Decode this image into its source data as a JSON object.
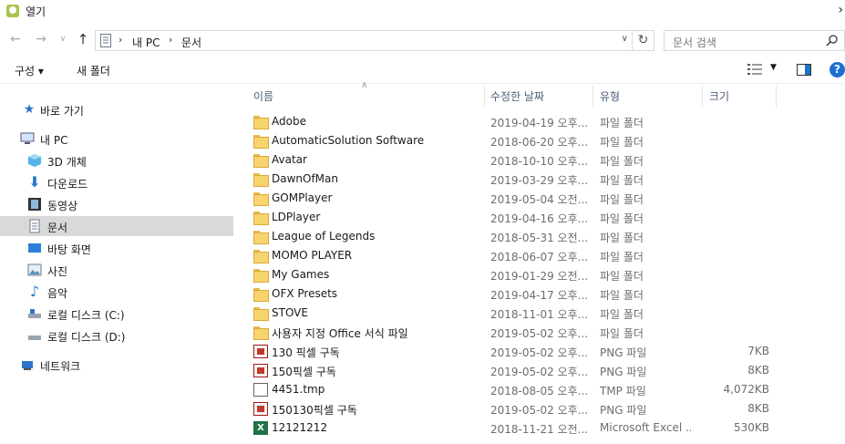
{
  "window": {
    "title": "열기"
  },
  "address": {
    "crumbs": [
      "내 PC",
      "문서"
    ],
    "search_placeholder": "문서 검색"
  },
  "toolbar": {
    "organize_label": "구성 ▾",
    "new_folder_label": "새 폴더"
  },
  "sidebar": {
    "items": [
      {
        "label": "바로 가기",
        "icon": "star-icon"
      },
      {
        "label": "내 PC",
        "icon": "pc-icon"
      },
      {
        "label": "3D 개체",
        "icon": "cube-3d-icon"
      },
      {
        "label": "다운로드",
        "icon": "download-icon"
      },
      {
        "label": "동영상",
        "icon": "video-icon"
      },
      {
        "label": "문서",
        "icon": "document-icon",
        "selected": true
      },
      {
        "label": "바탕 화면",
        "icon": "desktop-icon"
      },
      {
        "label": "사진",
        "icon": "picture-icon"
      },
      {
        "label": "음악",
        "icon": "music-icon"
      },
      {
        "label": "로컬 디스크 (C:)",
        "icon": "drive-icon"
      },
      {
        "label": "로컬 디스크 (D:)",
        "icon": "drive-icon"
      },
      {
        "label": "네트워크",
        "icon": "network-icon"
      }
    ]
  },
  "columns": {
    "name": "이름",
    "modified": "수정한 날짜",
    "type": "유형",
    "size": "크기"
  },
  "files": [
    {
      "name": "Adobe",
      "date": "2019-04-19 오후...",
      "type": "파일 폴더",
      "size": "",
      "icon": "folder"
    },
    {
      "name": "AutomaticSolution Software",
      "date": "2018-06-20 오후...",
      "type": "파일 폴더",
      "size": "",
      "icon": "folder"
    },
    {
      "name": "Avatar",
      "date": "2018-10-10 오후...",
      "type": "파일 폴더",
      "size": "",
      "icon": "folder"
    },
    {
      "name": "DawnOfMan",
      "date": "2019-03-29 오후...",
      "type": "파일 폴더",
      "size": "",
      "icon": "folder"
    },
    {
      "name": "GOMPlayer",
      "date": "2019-05-04 오전...",
      "type": "파일 폴더",
      "size": "",
      "icon": "folder"
    },
    {
      "name": "LDPlayer",
      "date": "2019-04-16 오후...",
      "type": "파일 폴더",
      "size": "",
      "icon": "folder"
    },
    {
      "name": "League of Legends",
      "date": "2018-05-31 오전...",
      "type": "파일 폴더",
      "size": "",
      "icon": "folder"
    },
    {
      "name": "MOMO PLAYER",
      "date": "2018-06-07 오후...",
      "type": "파일 폴더",
      "size": "",
      "icon": "folder"
    },
    {
      "name": "My Games",
      "date": "2019-01-29 오전...",
      "type": "파일 폴더",
      "size": "",
      "icon": "folder"
    },
    {
      "name": "OFX Presets",
      "date": "2019-04-17 오후...",
      "type": "파일 폴더",
      "size": "",
      "icon": "folder"
    },
    {
      "name": "STOVE",
      "date": "2018-11-01 오후...",
      "type": "파일 폴더",
      "size": "",
      "icon": "folder"
    },
    {
      "name": "사용자 지정 Office 서식 파일",
      "date": "2019-05-02 오후...",
      "type": "파일 폴더",
      "size": "",
      "icon": "folder"
    },
    {
      "name": "130 픽셀 구독",
      "date": "2019-05-02 오후...",
      "type": "PNG 파일",
      "size": "7KB",
      "icon": "png"
    },
    {
      "name": "150픽셀 구독",
      "date": "2019-05-02 오후...",
      "type": "PNG 파일",
      "size": "8KB",
      "icon": "png"
    },
    {
      "name": "4451.tmp",
      "date": "2018-08-05 오후...",
      "type": "TMP 파일",
      "size": "4,072KB",
      "icon": "tmp"
    },
    {
      "name": "150130픽셀 구독",
      "date": "2019-05-02 오후...",
      "type": "PNG 파일",
      "size": "8KB",
      "icon": "png"
    },
    {
      "name": "12121212",
      "date": "2018-11-21 오전...",
      "type": "Microsoft Excel ...",
      "size": "530KB",
      "icon": "xls"
    }
  ]
}
